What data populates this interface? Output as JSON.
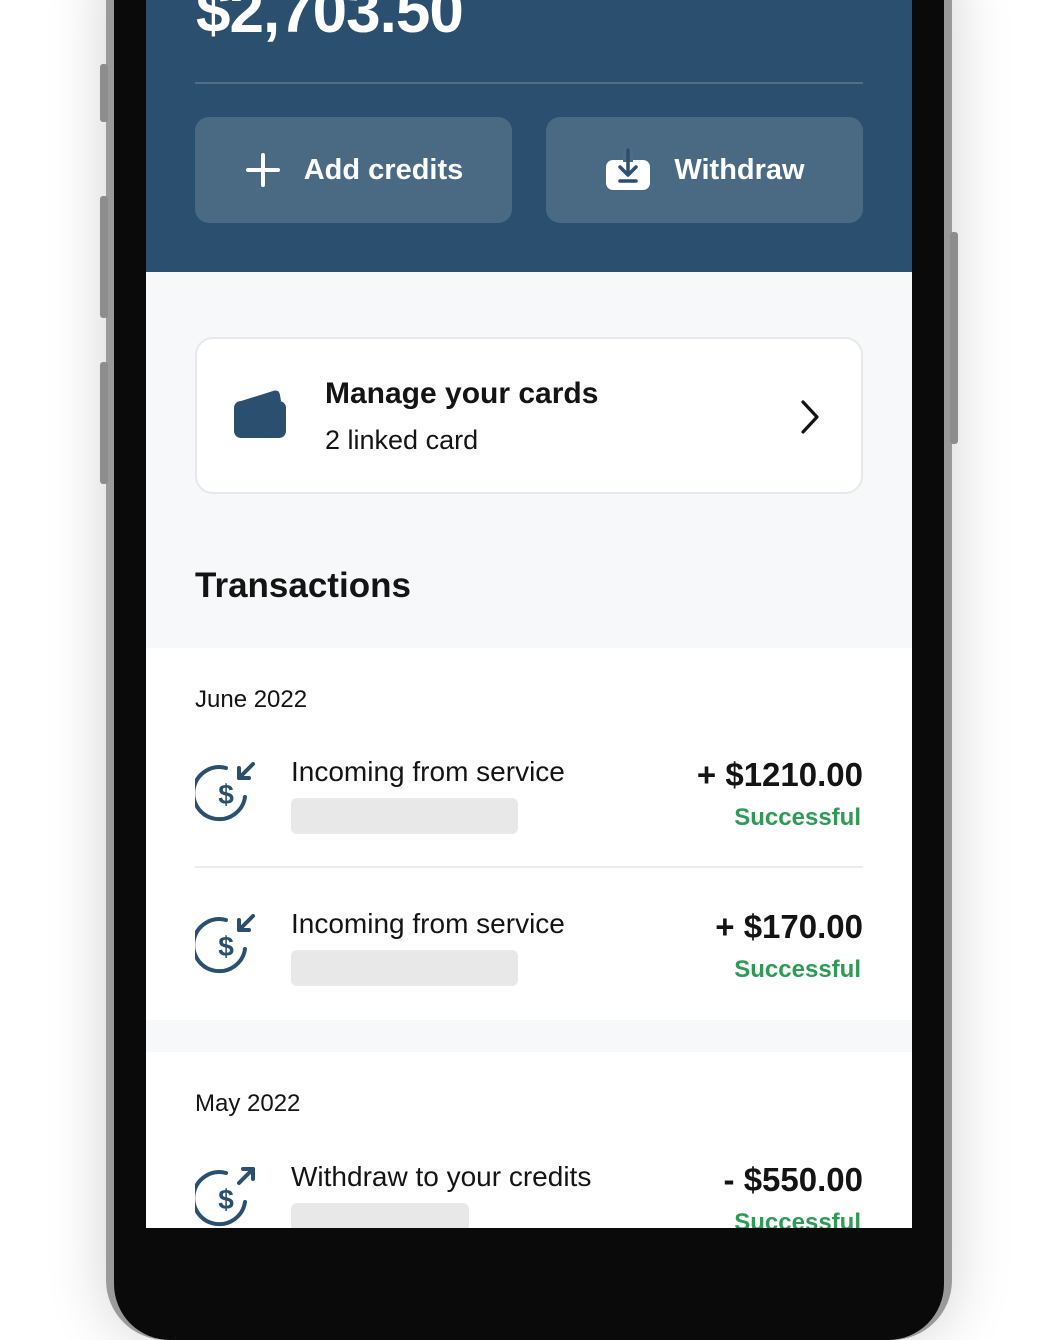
{
  "wallet": {
    "balance": "$2,703.50"
  },
  "actions": {
    "add_credits_label": "Add credits",
    "withdraw_label": "Withdraw"
  },
  "cards": {
    "title": "Manage your cards",
    "subtitle": "2 linked card"
  },
  "transactions": {
    "heading": "Transactions",
    "groups": [
      {
        "label": "June 2022",
        "items": [
          {
            "name": "Incoming from service",
            "amount": "+ $1210.00",
            "status": "Successful",
            "icon": "incoming-dollar-icon"
          },
          {
            "name": "Incoming from service",
            "amount": "+ $170.00",
            "status": "Successful",
            "icon": "incoming-dollar-icon"
          }
        ]
      },
      {
        "label": "May 2022",
        "items": [
          {
            "name": "Withdraw to your credits",
            "amount": "- $550.00",
            "status": "Successful",
            "icon": "outgoing-dollar-icon"
          }
        ]
      }
    ]
  },
  "colors": {
    "header_bg": "#2b4f6e",
    "icon": "#2b4f6e",
    "success": "#2f9a56"
  }
}
